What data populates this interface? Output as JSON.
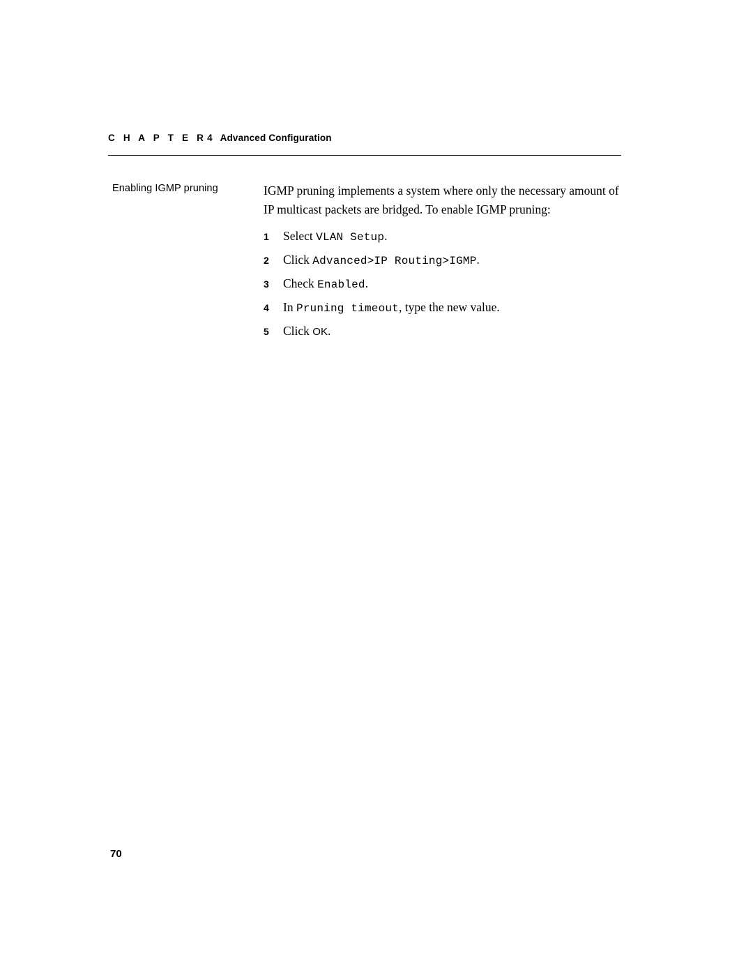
{
  "header": {
    "chapter_word": "C H A P T E R",
    "chapter_number": "4",
    "chapter_title": "Advanced Configuration"
  },
  "side_heading": "Enabling IGMP pruning",
  "intro": "IGMP pruning implements a system where only the necessary amount of IP multicast packets are bridged. To enable IGMP pruning:",
  "steps": [
    {
      "num": "1",
      "lead": "Select ",
      "mono": "VLAN Setup",
      "tail": "."
    },
    {
      "num": "2",
      "lead": "Click ",
      "mono": "Advanced>IP Routing>IGMP",
      "tail": "."
    },
    {
      "num": "3",
      "lead": "Check ",
      "mono": "Enabled",
      "tail": "."
    },
    {
      "num": "4",
      "lead": "In ",
      "mono": "Pruning timeout",
      "tail": ", type the new value."
    },
    {
      "num": "5",
      "lead": "Click ",
      "mono_small": "OK",
      "tail": "."
    }
  ],
  "page_number": "70"
}
